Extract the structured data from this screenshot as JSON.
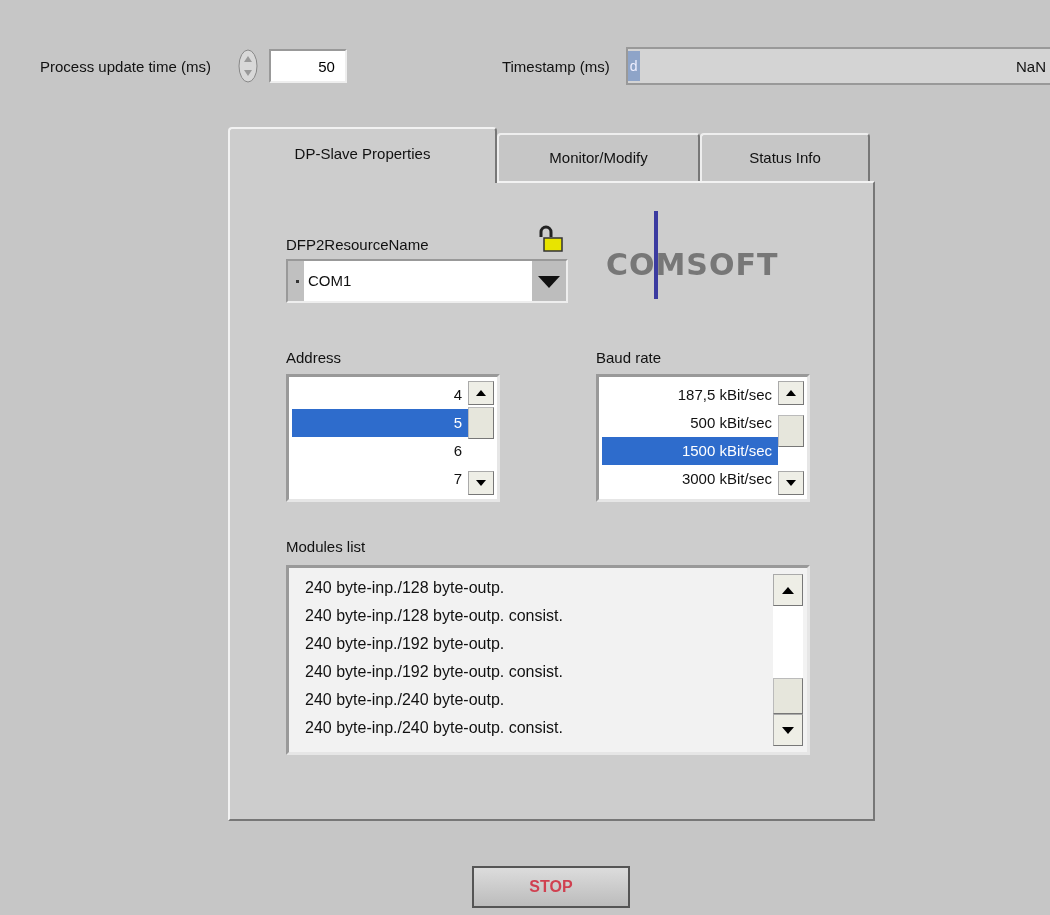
{
  "process_update_time": {
    "label": "Process update time (ms)",
    "value": "50"
  },
  "timestamp": {
    "label": "Timestamp (ms)",
    "radix": "d",
    "value": "NaN"
  },
  "tabs": [
    {
      "label": "DP-Slave Properties",
      "selected": true
    },
    {
      "label": "Monitor/Modify",
      "selected": false
    },
    {
      "label": "Status Info",
      "selected": false
    }
  ],
  "resource": {
    "label": "DFP2ResourceName",
    "locked": false,
    "value": "COM1"
  },
  "logo": {
    "text": "COMSOFT"
  },
  "address": {
    "label": "Address",
    "items": [
      {
        "text": "4",
        "selected": false
      },
      {
        "text": "5",
        "selected": true
      },
      {
        "text": "6",
        "selected": false
      },
      {
        "text": "7",
        "selected": false
      }
    ]
  },
  "baud_rate": {
    "label": "Baud rate",
    "items": [
      {
        "text": "187,5 kBit/sec",
        "selected": false
      },
      {
        "text": "500 kBit/sec",
        "selected": false
      },
      {
        "text": "1500 kBit/sec",
        "selected": true
      },
      {
        "text": "3000 kBit/sec",
        "selected": false
      }
    ]
  },
  "modules": {
    "label": "Modules list",
    "items": [
      "240 byte-inp./128 byte-outp.",
      "240 byte-inp./128 byte-outp. consist.",
      "240 byte-inp./192 byte-outp.",
      "240 byte-inp./192 byte-outp. consist.",
      "240 byte-inp./240 byte-outp.",
      "240 byte-inp./240 byte-outp. consist."
    ]
  },
  "stop_button": {
    "label": "STOP"
  }
}
